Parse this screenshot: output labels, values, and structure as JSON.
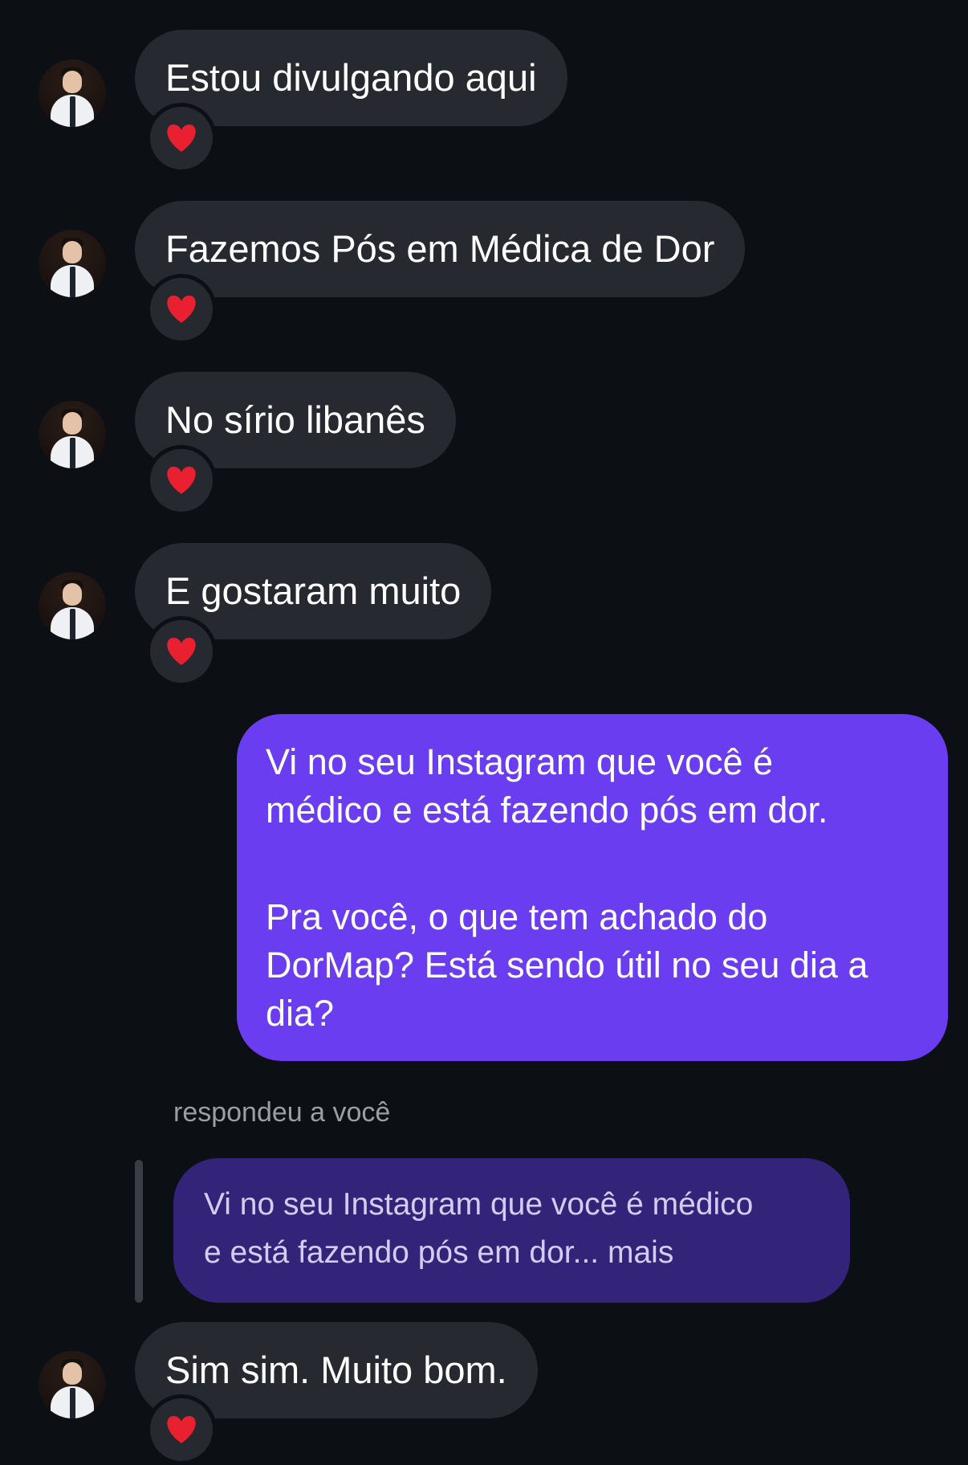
{
  "conversation": {
    "messages_in": [
      {
        "text": "Estou divulgando aqui",
        "reaction": "heart"
      },
      {
        "text": "Fazemos Pós em Médica de Dor",
        "reaction": "heart"
      },
      {
        "text": "No sírio libanês",
        "reaction": "heart"
      },
      {
        "text": "E gostaram muito",
        "reaction": "heart"
      }
    ],
    "message_out": {
      "paragraph1_line1": "Vi no seu Instagram que você é",
      "paragraph1_line2": "médico e está fazendo pós em dor.",
      "paragraph2_line1": "Pra você, o que tem achado do",
      "paragraph2_line2": "DorMap? Está sendo útil no seu dia a",
      "paragraph2_line3": "dia?"
    },
    "reply": {
      "label": "respondeu a você",
      "quote_line1": "Vi no seu Instagram que você é médico",
      "quote_line2": "e está fazendo pós em dor... mais",
      "message": {
        "text": "Sim sim. Muito bom.",
        "reaction": "heart"
      }
    }
  },
  "colors": {
    "background": "#0c0f14",
    "incoming_bubble": "#26292f",
    "outgoing_bubble": "#6a3ef0",
    "reply_quote_bubble": "#33247a",
    "reaction_heart": "#e8202f"
  },
  "icons": {
    "reaction": "red-heart-icon",
    "avatar": "profile-photo-man-white-shirt-tie"
  }
}
